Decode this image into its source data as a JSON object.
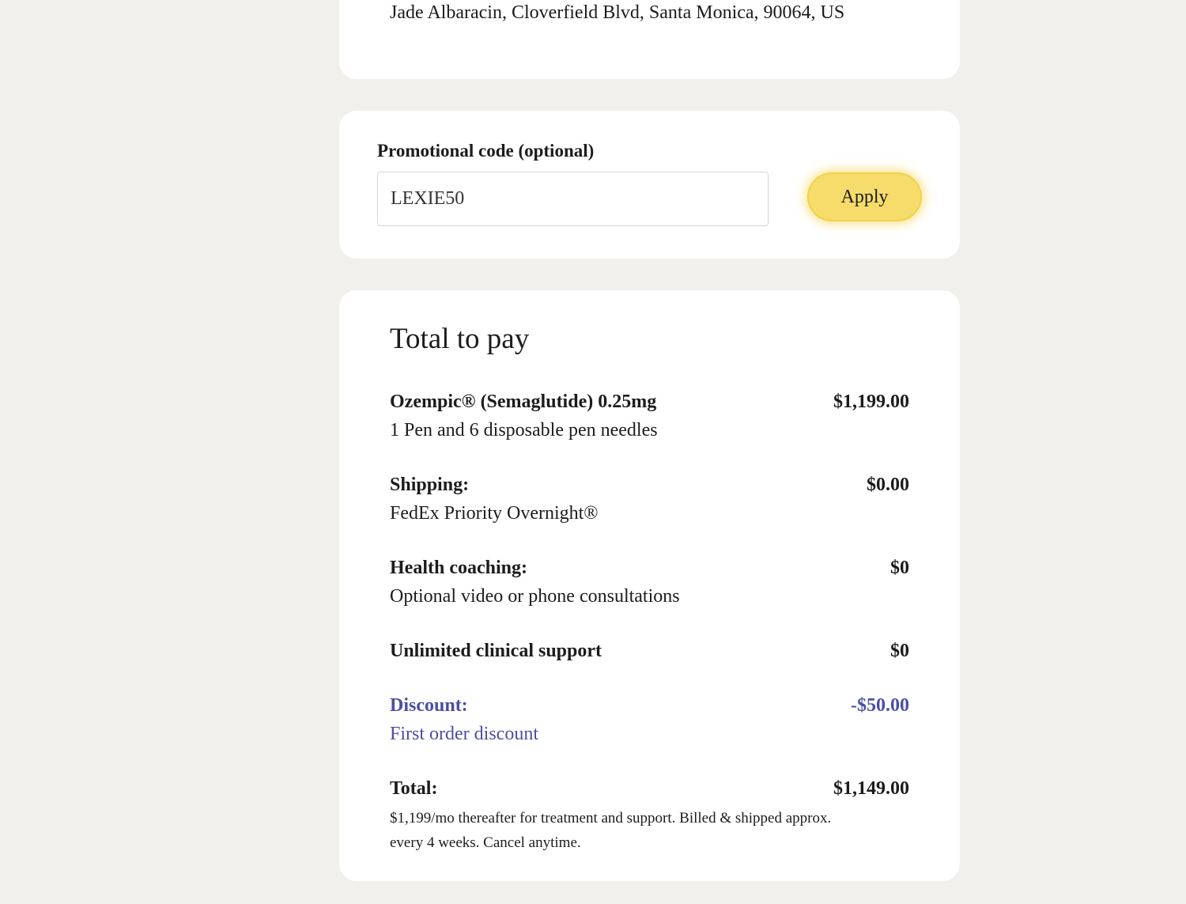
{
  "address": {
    "text": "Jade Albaracin, Cloverfield Blvd, Santa Monica, 90064, US"
  },
  "promo": {
    "label": "Promotional code (optional)",
    "value": "LEXIE50",
    "placeholder": "LEXIE50",
    "apply_label": "Apply",
    "button_color": "#f6dc6a"
  },
  "summary": {
    "heading": "Total to pay",
    "items": [
      {
        "title": "Ozempic® (Semaglutide) 0.25mg",
        "subtitle": "1 Pen and 6 disposable pen needles",
        "price": "$1,199.00"
      },
      {
        "title": "Shipping:",
        "subtitle": "FedEx Priority Overnight®",
        "price": "$0.00"
      },
      {
        "title": "Health coaching:",
        "subtitle": "Optional video or phone consultations",
        "price": "$0"
      },
      {
        "title": "Unlimited clinical support",
        "price": "$0"
      }
    ],
    "discount": {
      "title": "Discount:",
      "subtitle": "First order discount",
      "price": "-$50.00",
      "color": "#4a4fa3"
    },
    "total": {
      "title": "Total:",
      "price": "$1,149.00",
      "note": "$1,199/mo thereafter for treatment and support. Billed & shipped approx. every 4 weeks. Cancel anytime."
    }
  }
}
